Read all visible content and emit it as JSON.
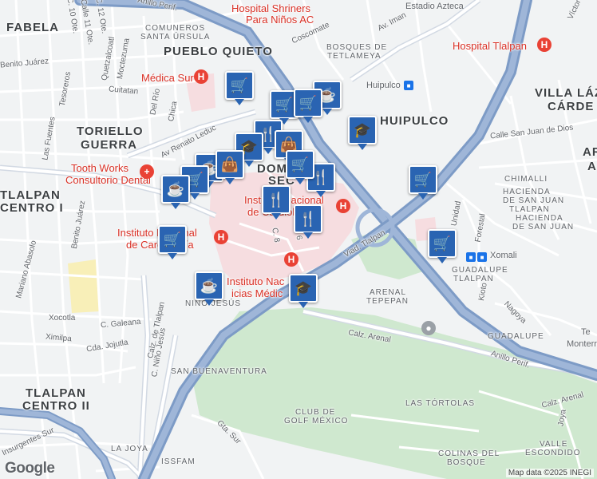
{
  "neighborhoods": [
    "FABELA",
    "PUEBLO QUIETO",
    "TORIELLO",
    "GUERRA",
    "TLALPAN",
    "CENTRO I",
    "HUIPULCO",
    "VILLA LÁZ",
    "CÁRDE",
    "TLALPAN",
    "CENTRO II",
    "DOMI",
    "SEC"
  ],
  "small_areas": [
    "COMUNEROS",
    "SANTA ÚRSULA",
    "BOSQUES DE",
    "TETLAMEYA",
    "CHIMALLI",
    "HACIENDA",
    "DE SAN JUAN",
    "TLALPAN",
    "HACIENDA",
    "DE SAN JUAN",
    "GUADALUPE",
    "TLALPAN",
    "ARENAL",
    "TEPEPAN",
    "GUADALUPE",
    "SAN BUENAVENTURA",
    "CLUB DE",
    "GOLF MÉXICO",
    "LAS TÓRTOLAS",
    "LA JOYA",
    "ISSFAM",
    "COLINAS DEL",
    "BOSQUE",
    "VALLE",
    "ESCONDIDO",
    "NIÑO JESÚS",
    "AR",
    "A",
    "Te",
    "Monterre"
  ],
  "streets": [
    "Anillo Perif.",
    "Av. Iman",
    "Coscomate",
    "Benito Juárez",
    "C. 12 Ote.",
    "Calle 11 Ote.",
    "C. 10 Ote.",
    "Quetzalcoatl",
    "Moctezuma",
    "Tesoreros",
    "Cuitatan",
    "Del Río",
    "Chica",
    "Av Renato Leduc",
    "Las Fuentes",
    "Benito Juárez",
    "Mariano Abasolo",
    "Xocotla",
    "C. Galeana",
    "Ximilpa",
    "Cda. Jojutla",
    "Calz. de Tlalpan",
    "C. Niño Jesús",
    "Viad. Tlalpan",
    "Calz. Arenal",
    "Anillo Perif.",
    "Calz. Arenal",
    "Unidad",
    "Forestal",
    "Kioto",
    "Nagoya",
    "Calle San Juan de Dios",
    "Víctor R",
    "Gta. Sur",
    "Insurgentes Sur",
    "Joya",
    "C. 8",
    "C. 6"
  ],
  "places": {
    "shriners": "Hospital Shriners",
    "shriners2": "Para Niños AC",
    "azteca": "Estadio Azteca",
    "tlalpan_hosp": "Hospital Tlalpan",
    "medica_sur": "Médica Sur",
    "tooth1": "Tooth Works",
    "tooth2": "Consultorio Dental",
    "cardio1": "Instituto Nacional",
    "cardio2": "de Cardiología",
    "cardio_b1": "Instituto Nacional",
    "cardio_b2": "de Cardiolo…",
    "medicas1": "Instituto Nac",
    "medicas2": "icias Médic",
    "huipulco_st": "Huipulco",
    "xomali": "Xomali",
    "tec1": "Te",
    "tec2": "Monterre"
  },
  "pins": [
    {
      "icon": "cart"
    },
    {
      "icon": "cart"
    },
    {
      "icon": "cup"
    },
    {
      "icon": "cart"
    },
    {
      "icon": "cap"
    },
    {
      "icon": "fork"
    },
    {
      "icon": "bag"
    },
    {
      "icon": "cap"
    },
    {
      "icon": "fork"
    },
    {
      "icon": "cup"
    },
    {
      "icon": "cart"
    },
    {
      "icon": "cart"
    },
    {
      "icon": "cart"
    },
    {
      "icon": "fork"
    },
    {
      "icon": "fork"
    },
    {
      "icon": "cup"
    },
    {
      "icon": "cap"
    },
    {
      "icon": "cart"
    },
    {
      "icon": "cart"
    }
  ],
  "google": "Google",
  "attribution": "Map data ©2025 INEGI"
}
